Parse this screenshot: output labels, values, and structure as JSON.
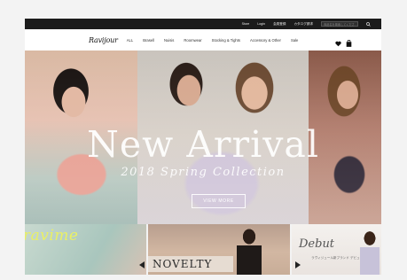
{
  "topbar": {
    "links": [
      "Store",
      "Login",
      "会員登録",
      "カタログ請求"
    ],
    "search_placeholder": "商品名を検索してください",
    "search_icon": "search-icon"
  },
  "nav": {
    "logo": "Ravijour",
    "items": [
      "ALL",
      "Brasell",
      "Nuisis",
      "Roomwear",
      "Stocking & Tights",
      "Accessory & Other",
      "Sale"
    ],
    "icons": [
      "heart-icon",
      "bag-icon"
    ]
  },
  "hero": {
    "title": "New Arrival",
    "subtitle": "2018 Spring Collection",
    "button": "VIEW MORE"
  },
  "banners": {
    "b1_text": "ravime",
    "b2_text": "NOVELTY",
    "b3_text": "Debut",
    "b3_small": "ラヴィジュール新ブランド デビュー"
  },
  "colors": {
    "topbar": "#1b1b1b",
    "accent_yellow": "#eaf064"
  }
}
